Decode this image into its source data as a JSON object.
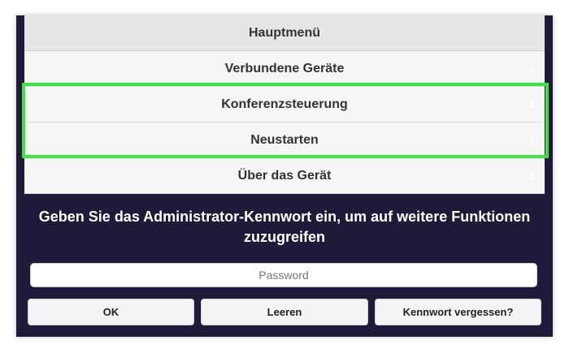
{
  "menu": {
    "header": "Hauptmenü",
    "items": [
      {
        "label": "Verbundene Geräte"
      },
      {
        "label": "Konferenzsteuerung"
      },
      {
        "label": "Neustarten"
      },
      {
        "label": "Über das Gerät"
      }
    ],
    "chevron": "›"
  },
  "login": {
    "prompt": "Geben Sie das Administrator-Kennwort ein, um auf weitere Funktionen zuzugreifen",
    "password_placeholder": "Password",
    "password_value": "",
    "ok_label": "OK",
    "clear_label": "Leeren",
    "forgot_label": "Kennwort vergessen?"
  },
  "colors": {
    "background": "#201a3a",
    "highlight": "#3ce63c"
  }
}
